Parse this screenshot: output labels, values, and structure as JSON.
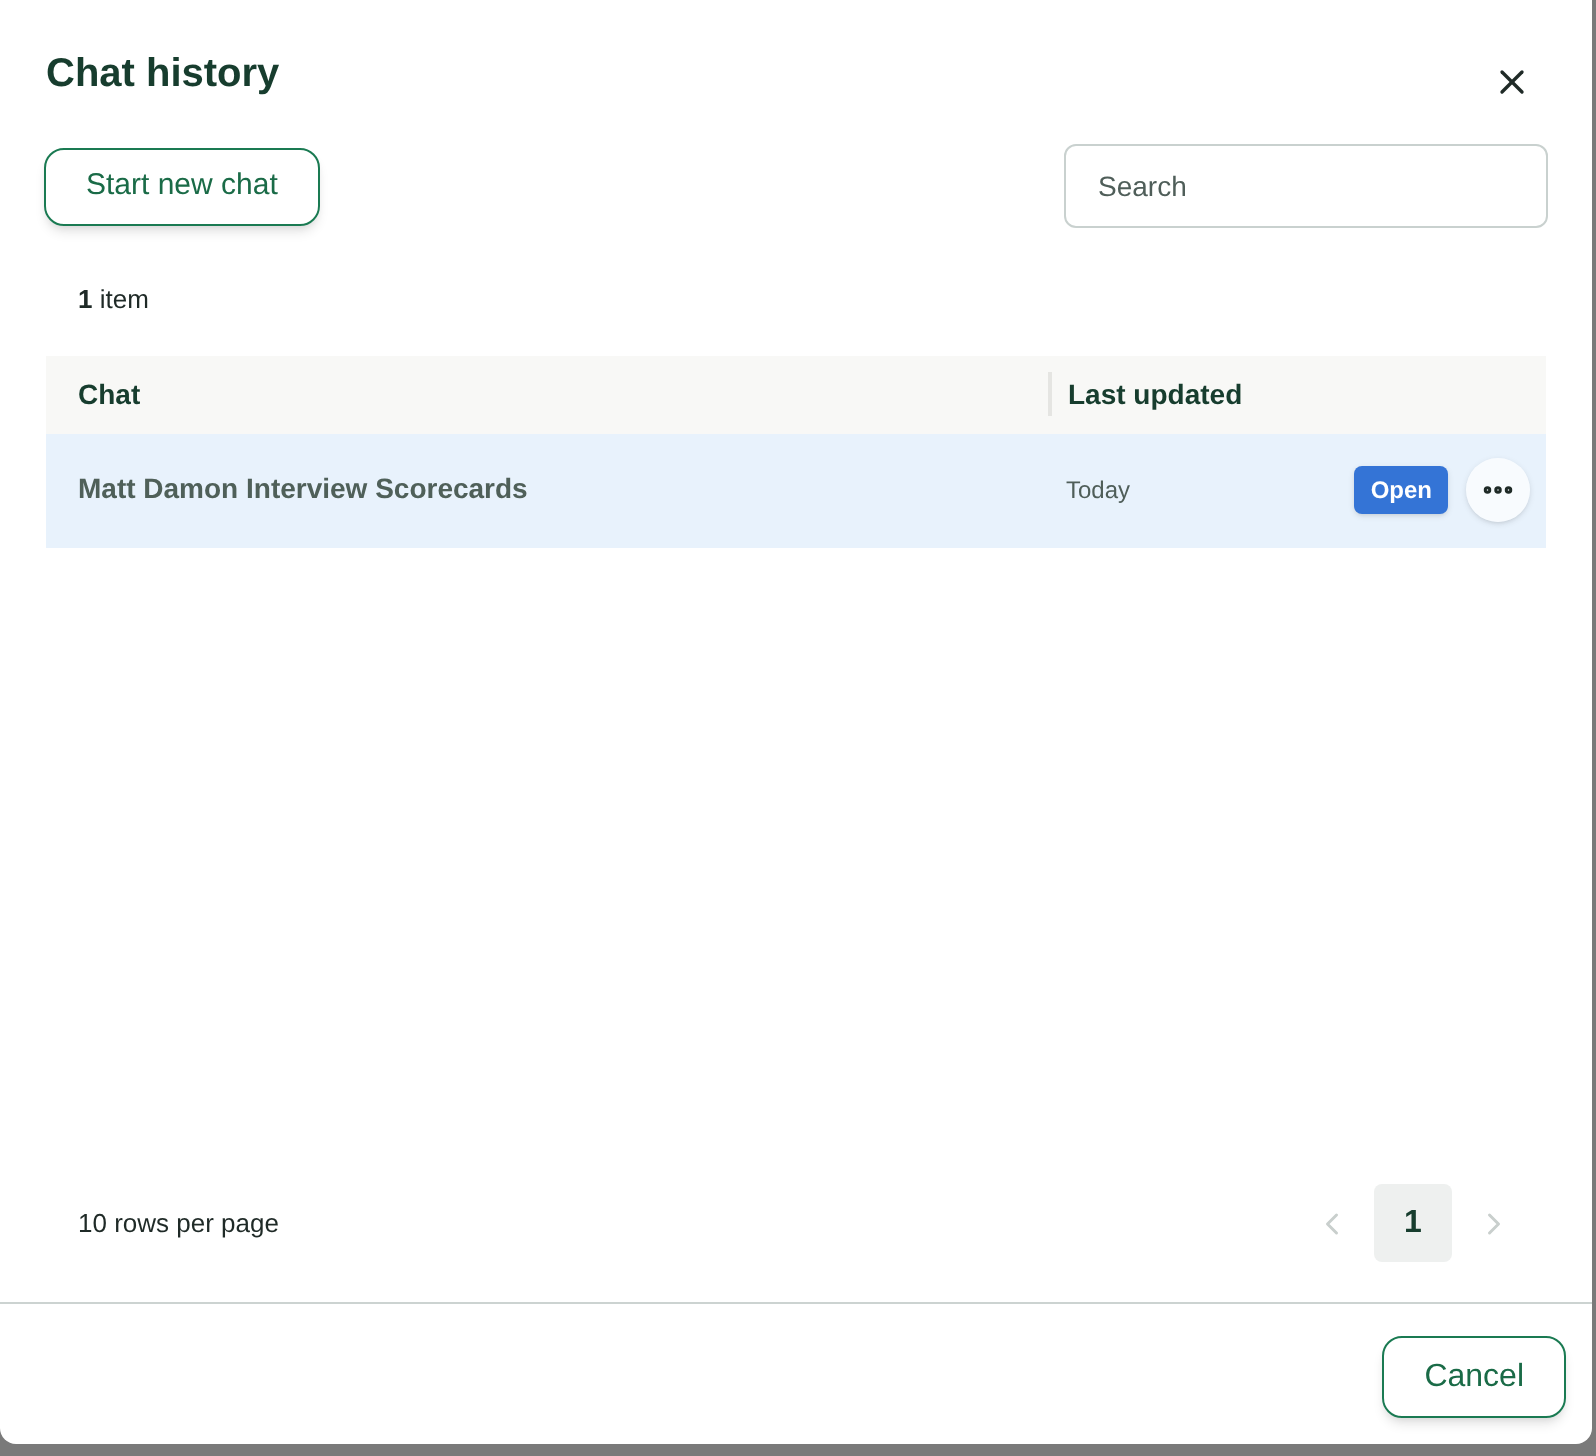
{
  "dialog": {
    "title": "Chat history"
  },
  "start_button": "Start new chat",
  "search": {
    "placeholder": "Search"
  },
  "item_count": "**1** item",
  "table": {
    "columns": [
      "Chat",
      "Last updated"
    ],
    "rows": [
      {
        "chat": "Matt Damon Interview Scorecards",
        "updated": "Today",
        "action": "Open",
        "selected": true
      }
    ]
  },
  "rows_per_page": "10 rows per page",
  "pagination": {
    "prev_disabled": true,
    "next_disabled": true,
    "pages": [
      {
        "label": "1",
        "selected": true
      }
    ]
  },
  "cancel_button": "Cancel"
}
